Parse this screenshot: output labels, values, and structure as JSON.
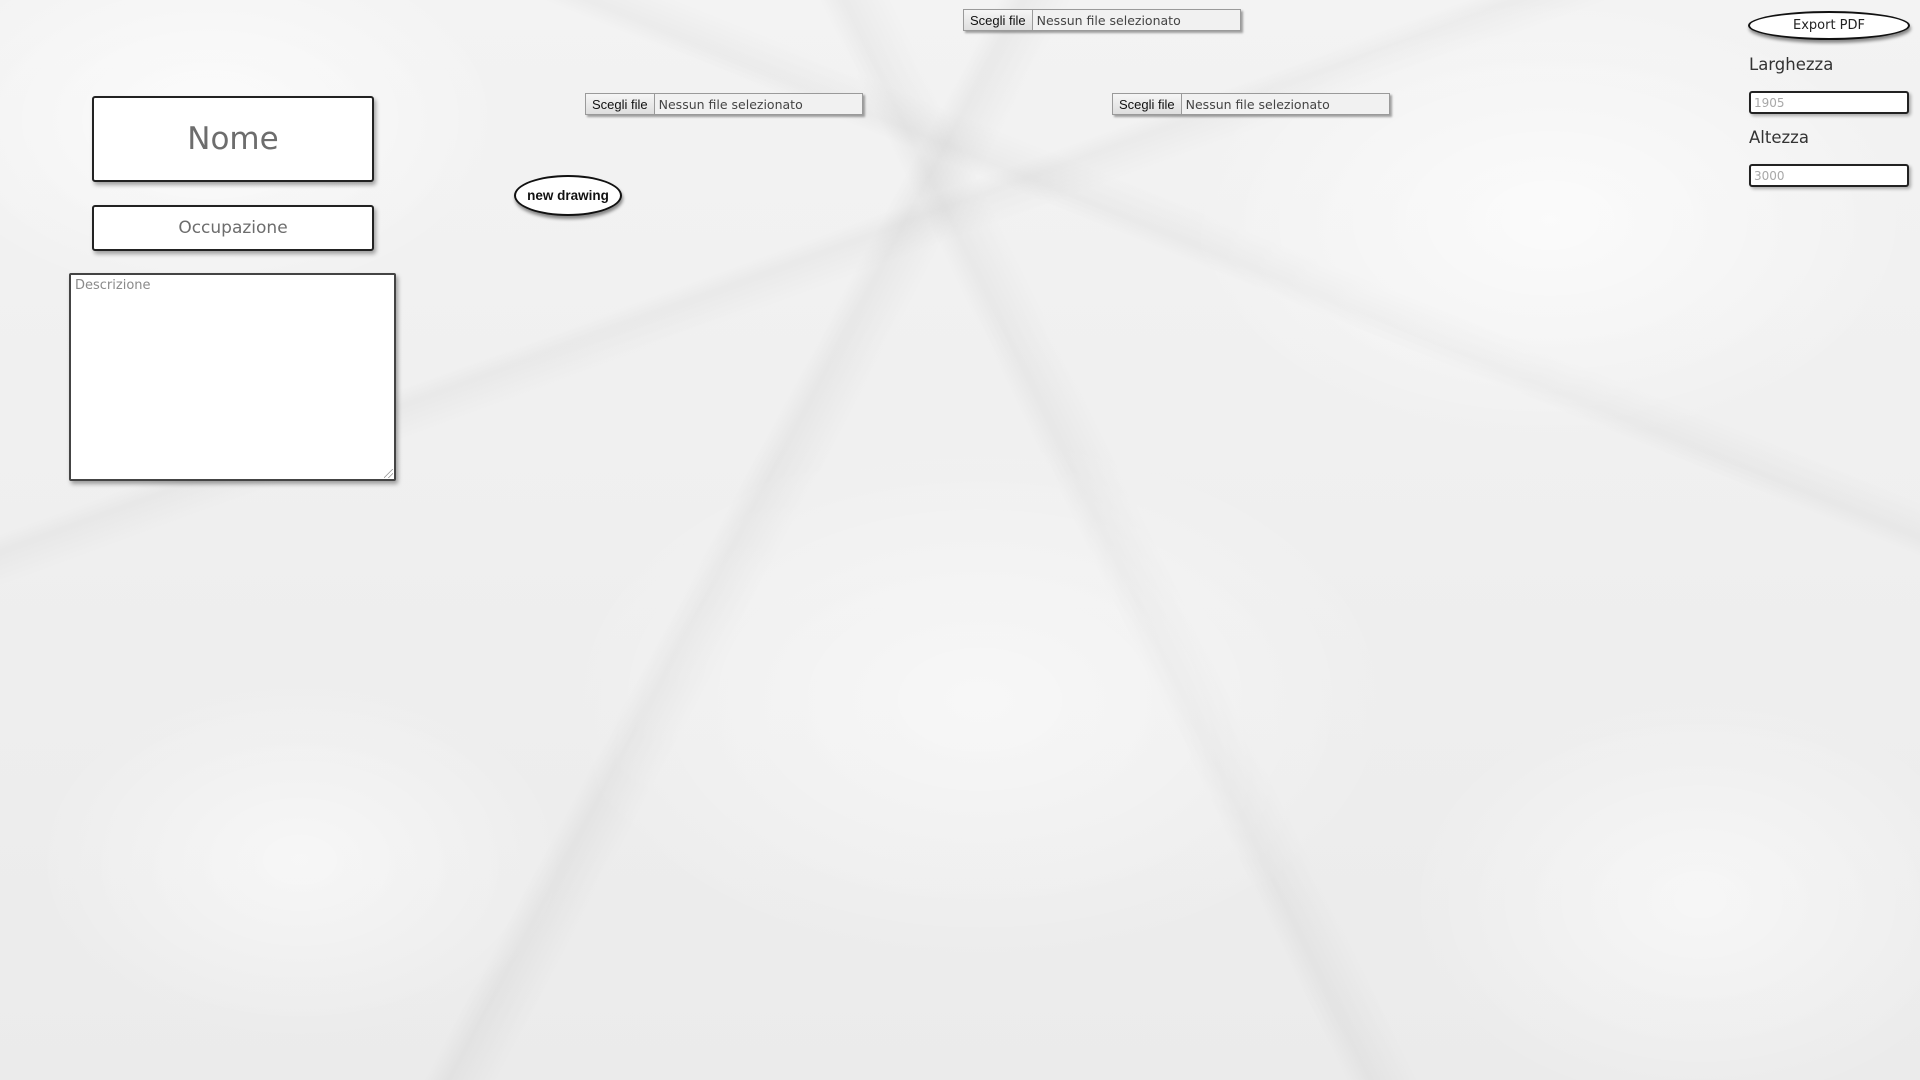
{
  "file_inputs": [
    {
      "button_label": "Scegli file",
      "status_text": "Nessun file selezionato"
    },
    {
      "button_label": "Scegli file",
      "status_text": "Nessun file selezionato"
    },
    {
      "button_label": "Scegli file",
      "status_text": "Nessun file selezionato"
    }
  ],
  "profile_form": {
    "name_placeholder": "Nome",
    "occupation_placeholder": "Occupazione",
    "description_placeholder": "Descrizione"
  },
  "drawing": {
    "new_drawing_label": "new drawing"
  },
  "export": {
    "export_label": "Export PDF",
    "width_label": "Larghezza",
    "width_placeholder": "1905",
    "height_label": "Altezza",
    "height_placeholder": "3000"
  },
  "colors": {
    "background": "#efefef",
    "border": "#222222"
  }
}
